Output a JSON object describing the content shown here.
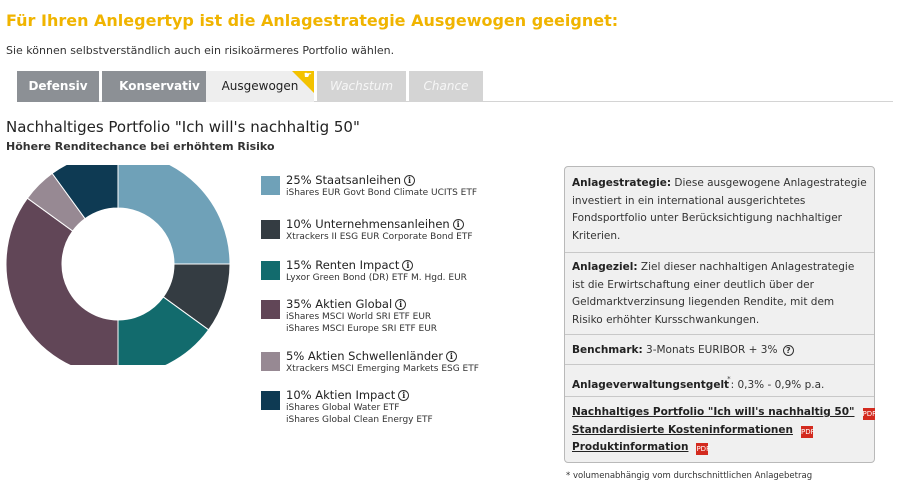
{
  "headline": "Für Ihren Anlegertyp ist die Anlagestrategie Ausgewogen geeignet:",
  "subheadline": "Sie können selbstverständlich auch ein risikoärmeres Portfolio wählen.",
  "tabs": [
    {
      "label": "Defensiv",
      "state": "enabled"
    },
    {
      "label": "Konservativ",
      "state": "enabled"
    },
    {
      "label": "Ausgewogen",
      "state": "active"
    },
    {
      "label": "Wachstum",
      "state": "disabled"
    },
    {
      "label": "Chance",
      "state": "disabled"
    }
  ],
  "portfolio": {
    "title": "Nachhaltiges Portfolio \"Ich will's nachhaltig 50\"",
    "subtitle": "Höhere Renditechance bei erhöhtem Risiko"
  },
  "chart_data": {
    "type": "pie",
    "donut": true,
    "start": "top",
    "direction": "clockwise",
    "series": [
      {
        "label": "25% Staatsanleihen",
        "value": 25,
        "color": "#6fa1b8",
        "funds": [
          "iShares EUR Govt Bond Climate UCITS ETF"
        ]
      },
      {
        "label": "10% Unternehmensanleihen",
        "value": 10,
        "color": "#343c42",
        "funds": [
          "Xtrackers II ESG EUR Corporate Bond ETF"
        ]
      },
      {
        "label": "15% Renten Impact",
        "value": 15,
        "color": "#126b6d",
        "funds": [
          "Lyxor Green Bond (DR) ETF M. Hgd. EUR"
        ]
      },
      {
        "label": "35% Aktien Global",
        "value": 35,
        "color": "#614657",
        "funds": [
          "iShares MSCI World SRI ETF EUR",
          "iShares MSCI Europe SRI ETF EUR"
        ]
      },
      {
        "label": "5% Aktien Schwellenländer",
        "value": 5,
        "color": "#978993",
        "funds": [
          "Xtrackers MSCI Emerging Markets ESG ETF"
        ]
      },
      {
        "label": "10% Aktien Impact",
        "value": 10,
        "color": "#0e3a53",
        "funds": [
          "iShares Global Water ETF",
          "iShares Global Clean Energy ETF"
        ]
      }
    ]
  },
  "info": {
    "strategy_label": "Anlagestrategie:",
    "strategy_text": "Diese ausgewogene Anlagestrategie investiert in ein international ausgerichtetes Fondsportfolio unter Berücksichtigung nachhaltiger Kriterien.",
    "goal_label": "Anlageziel:",
    "goal_text": "Ziel dieser nachhaltigen Anlagestrategie ist die Erwirtschaftung einer deutlich über der Geldmarktverzinsung liegenden Rendite, mit dem Risiko erhöhter Kursschwankungen.",
    "benchmark_label": "Benchmark:",
    "benchmark_text": "3-Monats EURIBOR + 3%",
    "fee_label": "Anlageverwaltungsentgelt",
    "fee_mark": "*",
    "fee_text": ": 0,3% - 0,9% p.a.",
    "documents": [
      "Nachhaltiges Portfolio \"Ich will's nachhaltig 50\"",
      "Standardisierte Kosteninformationen",
      "Produktinformation"
    ]
  },
  "footnote": "* volumenabhängig vom durchschnittlichen Anlagebetrag",
  "icons": {
    "info": "i",
    "help": "?",
    "pdf": "PDF"
  }
}
